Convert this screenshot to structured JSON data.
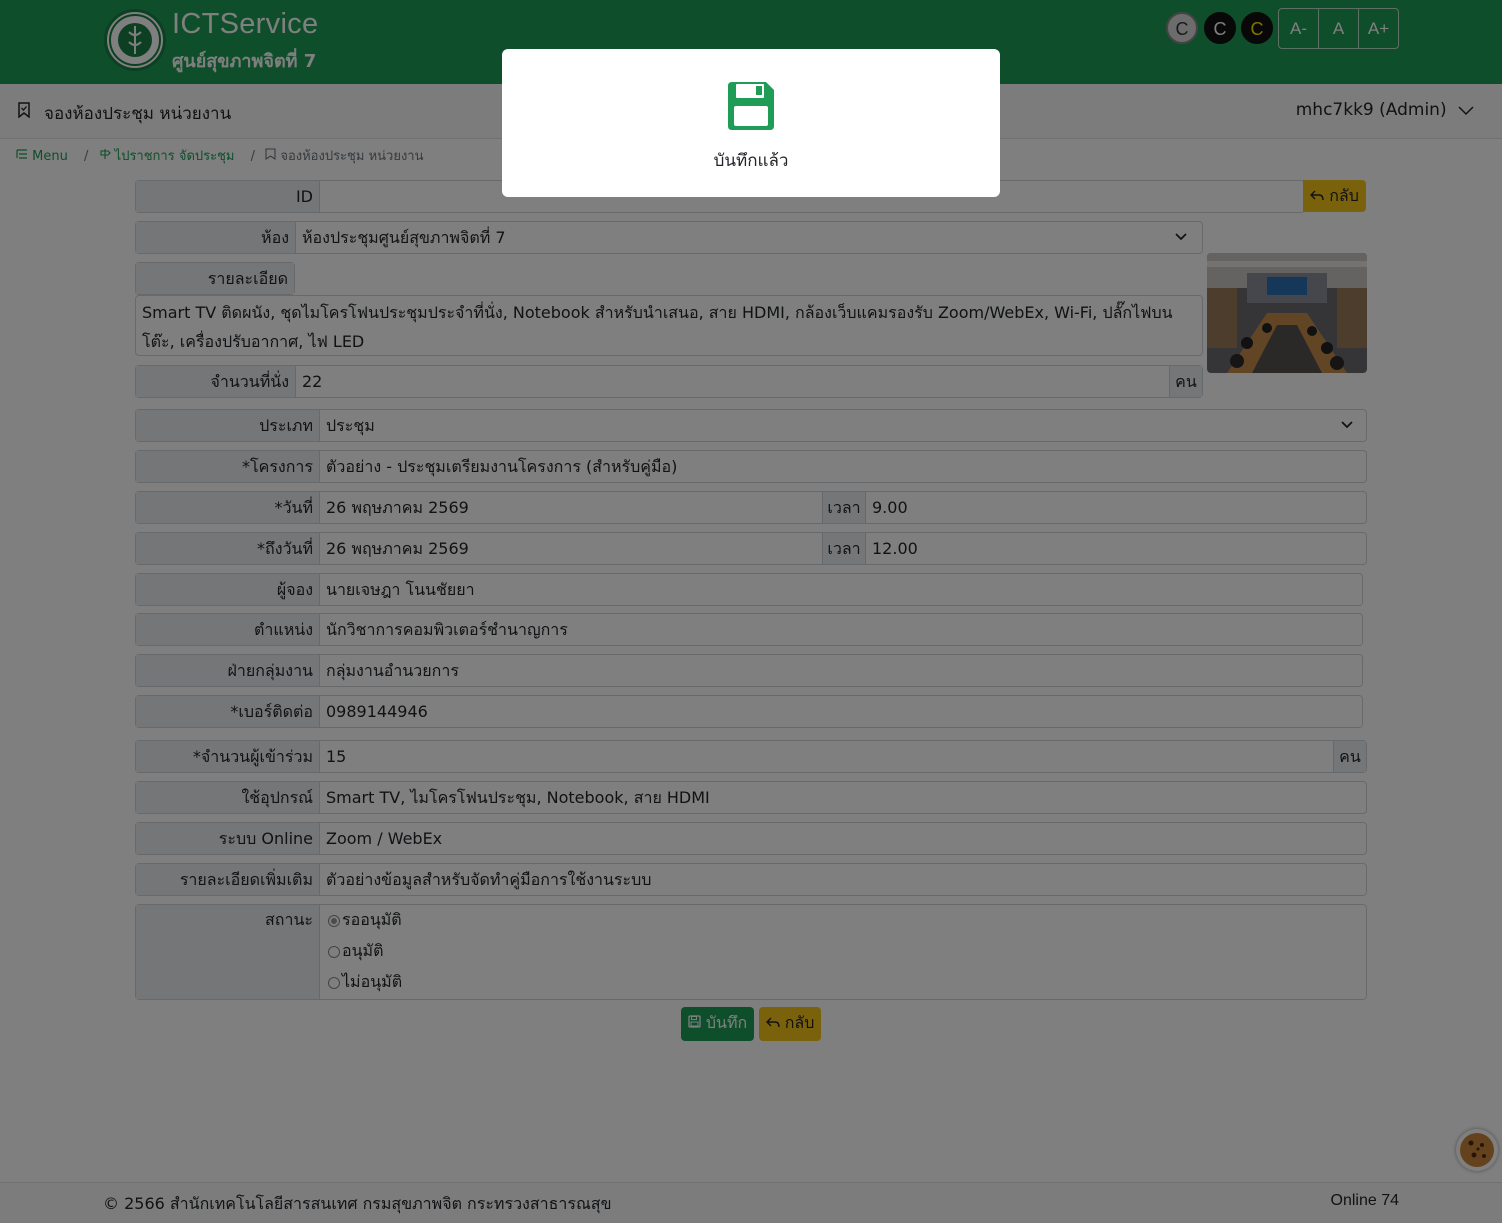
{
  "header": {
    "brand": "ICTService",
    "subtitle": "ศูนย์สุขภาพจิตที่ 7",
    "contrast_buttons": [
      "C",
      "C",
      "C"
    ],
    "font_buttons": [
      "A-",
      "A",
      "A+"
    ]
  },
  "topbar": {
    "title": "จองห้องประชุม หน่วยงาน",
    "user": "mhc7kk9 (Admin)"
  },
  "breadcrumb": {
    "items": [
      "Menu",
      "ไปราชการ จัดประชุม",
      "จองห้องประชุม หน่วยงาน"
    ],
    "separator": "/"
  },
  "form": {
    "id_label": "ID",
    "id_value": "",
    "back_top_label": "กลับ",
    "room_label": "ห้อง",
    "room_value": "ห้องประชุมศูนย์สุขภาพจิตที่ 7",
    "detail_label": "รายละเอียด",
    "detail_value": "Smart TV ติดผนัง, ชุดไมโครโฟนประชุมประจำที่นั่ง, Notebook สำหรับนำเสนอ, สาย HDMI, กล้องเว็บแคมรองรับ Zoom/WebEx, Wi-Fi, ปลั๊กไฟบนโต๊ะ, เครื่องปรับอากาศ, ไฟ LED",
    "seats_label": "จำนวนที่นั่ง",
    "seats_value": "22",
    "seats_unit": "คน",
    "type_label": "ประเภท",
    "type_value": "ประชุม",
    "project_label": "*โครงการ",
    "project_value": "ตัวอย่าง - ประชุมเตรียมงานโครงการ (สำหรับคู่มือ)",
    "date_label": "*วันที่",
    "date_value": "26 พฤษภาคม 2569",
    "time_label": "เวลา",
    "time_value": "9.00",
    "to_date_label": "*ถึงวันที่",
    "to_date_value": "26 พฤษภาคม 2569",
    "to_time_label": "เวลา",
    "to_time_value": "12.00",
    "booker_label": "ผู้จอง",
    "booker_value": "นายเจษฎา โนนชัยยา",
    "position_label": "ตำแหน่ง",
    "position_value": "นักวิชาการคอมพิวเตอร์ชำนาญการ",
    "dept_label": "ฝ่ายกลุ่มงาน",
    "dept_value": "กลุ่มงานอำนวยการ",
    "phone_label": "*เบอร์ติดต่อ",
    "phone_value": "0989144946",
    "attendees_label": "*จำนวนผู้เข้าร่วม",
    "attendees_value": "15",
    "attendees_unit": "คน",
    "equipment_label": "ใช้อุปกรณ์",
    "equipment_value": "Smart TV, ไมโครโฟนประชุม, Notebook, สาย HDMI",
    "online_label": "ระบบ Online",
    "online_value": "Zoom / WebEx",
    "more_label": "รายละเอียดเพิ่มเติม",
    "more_value": "ตัวอย่างข้อมูลสำหรับจัดทำคู่มือการใช้งานระบบ",
    "status_label": "สถานะ",
    "status_options": [
      "รออนุมัติ",
      "อนุมัติ",
      "ไม่อนุมัติ"
    ],
    "status_selected": "รออนุมัติ",
    "save_label": "บันทึก",
    "back_label": "กลับ"
  },
  "footer": {
    "copyright": "© 2566 สำนักเทคโนโลยีสารสนเทศ กรมสุขภาพจิต กระทรวงสาธารณสุข",
    "online": "Online 74"
  },
  "modal": {
    "message": "บันทึกแล้ว"
  },
  "colors": {
    "brand_green": "#1f9d57",
    "accent_yellow": "#f5c518"
  }
}
